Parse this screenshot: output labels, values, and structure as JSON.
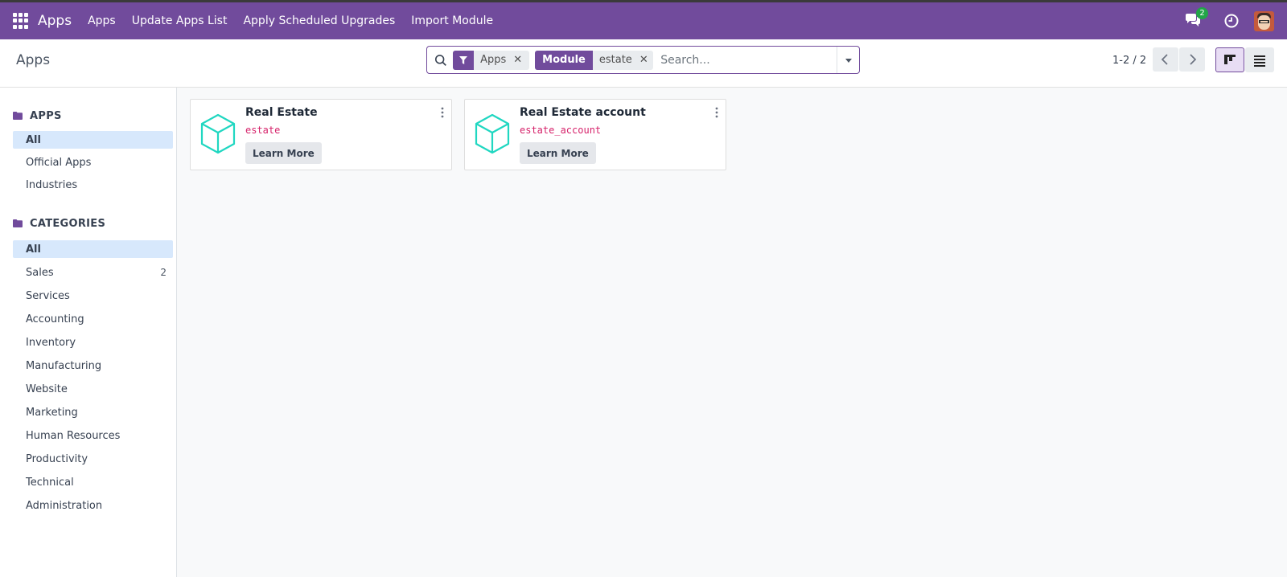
{
  "topbar": {
    "brand": "Apps",
    "menu": [
      "Apps",
      "Update Apps List",
      "Apply Scheduled Upgrades",
      "Import Module"
    ],
    "chat_badge": "2",
    "icons": [
      "apps-grid-icon",
      "chat-icon",
      "clock-icon",
      "user-avatar"
    ]
  },
  "control": {
    "title": "Apps",
    "search": {
      "facets": [
        {
          "type": "filter",
          "icon": "filter-icon",
          "value": "Apps"
        },
        {
          "type": "group",
          "label": "Module",
          "value": "estate"
        }
      ],
      "placeholder": "Search..."
    },
    "pager": "1-2 / 2",
    "views": [
      "kanban",
      "list"
    ],
    "active_view": "kanban"
  },
  "sidebar": {
    "sections": [
      {
        "title": "APPS",
        "items": [
          {
            "label": "All",
            "active": true
          },
          {
            "label": "Official Apps"
          },
          {
            "label": "Industries"
          }
        ]
      },
      {
        "title": "CATEGORIES",
        "items": [
          {
            "label": "All",
            "active": true
          },
          {
            "label": "Sales",
            "count": "2"
          },
          {
            "label": "Services"
          },
          {
            "label": "Accounting"
          },
          {
            "label": "Inventory"
          },
          {
            "label": "Manufacturing"
          },
          {
            "label": "Website"
          },
          {
            "label": "Marketing"
          },
          {
            "label": "Human Resources"
          },
          {
            "label": "Productivity"
          },
          {
            "label": "Technical"
          },
          {
            "label": "Administration"
          }
        ]
      }
    ]
  },
  "cards": [
    {
      "title": "Real Estate",
      "module": "estate",
      "button": "Learn More"
    },
    {
      "title": "Real Estate account",
      "module": "estate_account",
      "button": "Learn More"
    }
  ],
  "colors": {
    "primary": "#714b9c",
    "active_bg": "#d7e8fc",
    "module_code": "#d6236b",
    "module_icon": "#20d7c1",
    "badge": "#22a548"
  }
}
